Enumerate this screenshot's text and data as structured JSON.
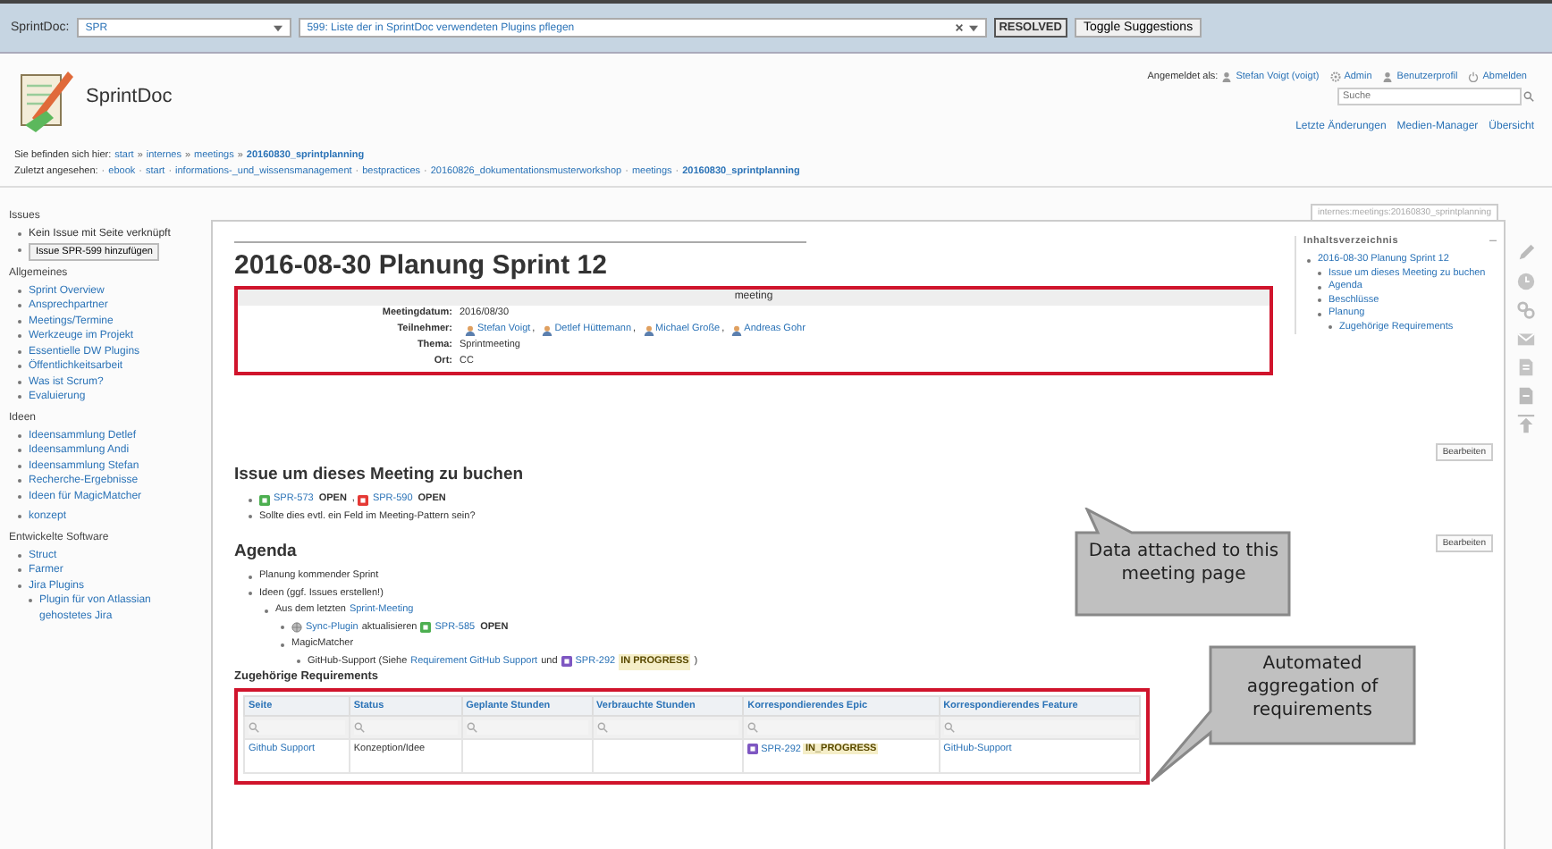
{
  "toolbar": {
    "label": "SprintDoc:",
    "project": "SPR",
    "issue": "599: Liste der in SprintDoc verwendeten Plugins pflegen",
    "status": "RESOLVED",
    "toggle": "Toggle Suggestions"
  },
  "site_title": "SprintDoc",
  "user_bar": {
    "label": "Angemeldet als:",
    "user": "Stefan Voigt (voigt)",
    "links": [
      {
        "kind": "gear",
        "text": "Admin"
      },
      {
        "kind": "person",
        "text": "Benutzerprofil"
      },
      {
        "kind": "power",
        "text": "Abmelden"
      }
    ]
  },
  "search": {
    "placeholder": "Suche"
  },
  "nav_links": [
    "Letzte Änderungen",
    "Medien-Manager",
    "Übersicht"
  ],
  "breadcrumbs": {
    "label": "Sie befinden sich hier:",
    "separator": "»",
    "items": [
      {
        "text": "start",
        "current": false
      },
      {
        "text": "internes",
        "current": false
      },
      {
        "text": "meetings",
        "current": false
      },
      {
        "text": "20160830_sprintplanning",
        "current": true
      }
    ]
  },
  "trace": {
    "label": "Zuletzt angesehen:",
    "separator": "·",
    "items": [
      {
        "text": "ebook",
        "current": false
      },
      {
        "text": "start",
        "current": false
      },
      {
        "text": "informations-_und_wissensmanagement",
        "current": false
      },
      {
        "text": "bestpractices",
        "current": false
      },
      {
        "text": "20160826_dokumentationsmusterworkshop",
        "current": false
      },
      {
        "text": "meetings",
        "current": false
      },
      {
        "text": "20160830_sprintplanning",
        "current": true
      }
    ]
  },
  "sidebar": [
    {
      "title": "Issues",
      "lists": [
        [
          {
            "kind": "text",
            "text": "Kein Issue mit Seite verknüpft"
          },
          {
            "kind": "button",
            "text": "Issue SPR-599 hinzufügen"
          }
        ]
      ]
    },
    {
      "title": "Allgemeines",
      "lists": [
        [
          {
            "kind": "link",
            "text": "Sprint Overview"
          },
          {
            "kind": "link",
            "text": "Ansprechpartner"
          },
          {
            "kind": "link",
            "text": "Meetings/Termine"
          },
          {
            "kind": "link",
            "text": "Werkzeuge im Projekt"
          },
          {
            "kind": "link",
            "text": "Essentielle DW Plugins"
          },
          {
            "kind": "link",
            "text": "Öffentlichkeitsarbeit"
          },
          {
            "kind": "link",
            "text": "Was ist Scrum?"
          },
          {
            "kind": "link",
            "text": "Evaluierung"
          }
        ]
      ]
    },
    {
      "title": "Ideen",
      "lists": [
        [
          {
            "kind": "link",
            "text": "Ideensammlung Detlef"
          },
          {
            "kind": "link",
            "text": "Ideensammlung Andi"
          },
          {
            "kind": "link",
            "text": "Ideensammlung Stefan"
          },
          {
            "kind": "link",
            "text": "Recherche-Ergebnisse"
          },
          {
            "kind": "link",
            "text": "Ideen für MagicMatcher"
          }
        ],
        [
          {
            "kind": "link",
            "text": "konzept"
          }
        ]
      ]
    },
    {
      "title": "Entwickelte Software",
      "lists": [
        [
          {
            "kind": "link",
            "text": "Struct"
          },
          {
            "kind": "link",
            "text": "Farmer"
          },
          {
            "kind": "link",
            "text": "Jira Plugins",
            "children": [
              {
                "kind": "link",
                "text": "Plugin für von Atlassian gehostetes Jira"
              }
            ]
          }
        ]
      ]
    }
  ],
  "page_id": "internes:meetings:20160830_sprintplanning",
  "title": "2016-08-30 Planung Sprint 12",
  "meeting": {
    "header": "meeting",
    "fields": [
      {
        "label": "Meetingdatum:",
        "kind": "text",
        "value": "2016/08/30"
      },
      {
        "label": "Teilnehmer:",
        "kind": "people",
        "separator": ",",
        "people": [
          "Stefan Voigt",
          "Detlef Hüttemann",
          "Michael Große",
          "Andreas Gohr"
        ]
      },
      {
        "label": "Thema:",
        "kind": "text",
        "value": "Sprintmeeting"
      },
      {
        "label": "Ort:",
        "kind": "text",
        "value": "CC"
      }
    ]
  },
  "issue_section": {
    "heading": "Issue um dieses Meeting zu buchen",
    "items": [
      {
        "parts": [
          {
            "kind": "issue",
            "key": "SPR-573",
            "status": "OPEN",
            "color": "#4caf50",
            "highlight": false
          },
          {
            "kind": "text",
            "text": ","
          },
          {
            "kind": "issue",
            "key": "SPR-590",
            "status": "OPEN",
            "color": "#e53935",
            "highlight": false
          }
        ]
      },
      {
        "parts": [
          {
            "kind": "text",
            "text": "Sollte dies evtl. ein Feld im Meeting-Pattern sein?"
          }
        ]
      }
    ]
  },
  "agenda": {
    "heading": "Agenda",
    "items": [
      {
        "parts": [
          {
            "kind": "text",
            "text": "Planung kommender Sprint"
          }
        ]
      },
      {
        "parts": [
          {
            "kind": "text",
            "text": "Ideen (ggf. Issues erstellen!)"
          }
        ],
        "children": [
          {
            "parts": [
              {
                "kind": "text",
                "text": "Aus dem letzten"
              },
              {
                "kind": "link",
                "text": "Sprint-Meeting"
              }
            ],
            "children": [
              {
                "parts": [
                  {
                    "kind": "plugin",
                    "text": "Sync-Plugin"
                  },
                  {
                    "kind": "text",
                    "text": "aktualisieren"
                  },
                  {
                    "kind": "issue",
                    "key": "SPR-585",
                    "status": "OPEN",
                    "color": "#4caf50",
                    "highlight": false
                  }
                ]
              },
              {
                "parts": [
                  {
                    "kind": "text",
                    "text": "MagicMatcher"
                  }
                ],
                "children": [
                  {
                    "parts": [
                      {
                        "kind": "text",
                        "text": "GitHub-Support (Siehe"
                      },
                      {
                        "kind": "link",
                        "text": "Requirement GitHub Support"
                      },
                      {
                        "kind": "text",
                        "text": "und"
                      },
                      {
                        "kind": "issue",
                        "key": "SPR-292",
                        "status": "IN PROGRESS",
                        "color": "#7e57c2",
                        "highlight": true
                      },
                      {
                        "kind": "text",
                        "text": ")"
                      }
                    ]
                  }
                ]
              }
            ]
          }
        ]
      }
    ]
  },
  "requirements": {
    "heading": "Zugehörige Requirements",
    "columns": [
      "Seite",
      "Status",
      "Geplante Stunden",
      "Verbrauchte Stunden",
      "Korrespondierendes Epic",
      "Korrespondierendes Feature"
    ],
    "rows": [
      [
        {
          "kind": "link",
          "text": "Github Support"
        },
        {
          "kind": "text",
          "text": "Konzeption/Idee"
        },
        {
          "kind": "empty"
        },
        {
          "kind": "empty"
        },
        {
          "kind": "issue",
          "key": "SPR-292",
          "status": "IN_PROGRESS",
          "color": "#7e57c2",
          "highlight": true
        },
        {
          "kind": "link",
          "text": "GitHub-Support"
        }
      ]
    ]
  },
  "toc": {
    "title": "Inhaltsverzeichnis",
    "items": [
      {
        "text": "2016-08-30 Planung Sprint 12",
        "children": [
          {
            "text": "Issue um dieses Meeting zu buchen"
          },
          {
            "text": "Agenda"
          },
          {
            "text": "Beschlüsse"
          },
          {
            "text": "Planung",
            "children": [
              {
                "text": "Zugehörige Requirements"
              }
            ]
          }
        ]
      }
    ]
  },
  "edit_buttons": [
    "Bearbeiten",
    "Bearbeiten"
  ],
  "callouts": [
    "Data attached to this meeting page",
    "Automated aggregation of requirements"
  ]
}
